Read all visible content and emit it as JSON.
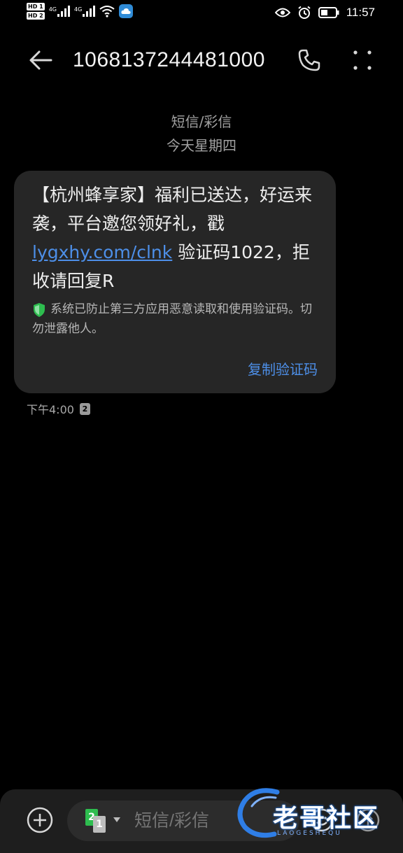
{
  "status_bar": {
    "hd_badges": [
      "HD 1",
      "HD 2"
    ],
    "network_tags": [
      "4G",
      "4G"
    ],
    "time": "11:57",
    "icons": [
      "eye-icon",
      "alarm-icon",
      "battery-icon",
      "wifi-icon",
      "cloud-app-icon"
    ]
  },
  "app_bar": {
    "contact": "1068137244481000",
    "icons": [
      "back-arrow-icon",
      "phone-icon",
      "more-vertical-icon"
    ]
  },
  "conversation": {
    "thread_type": "短信/彩信",
    "date_separator": "今天星期四",
    "message": {
      "text_before_link": "【杭州蜂享家】福利已送达，好运来袭，平台邀您领好礼，戳",
      "link": "lygxhy.com/clnk",
      "text_after_link": " 验证码1022，拒收请回复R",
      "security_notice": "系统已防止第三方应用恶意读取和使用验证码。切勿泄露他人。",
      "copy_code_label": "复制验证码",
      "time": "下午4:00",
      "sim": "2"
    }
  },
  "composer": {
    "sim_primary": "2",
    "sim_secondary": "1",
    "placeholder": "短信/彩信",
    "icons": [
      "add-icon",
      "emoji-icon",
      "send-icon"
    ]
  },
  "watermark": {
    "text": "老哥社区",
    "sub": "LAOGESHEQU"
  },
  "colors": {
    "background": "#000000",
    "bubble": "#262626",
    "accent": "#4d8fe8",
    "shield": "#2ebd4f",
    "sim_green": "#2ebd4f"
  }
}
